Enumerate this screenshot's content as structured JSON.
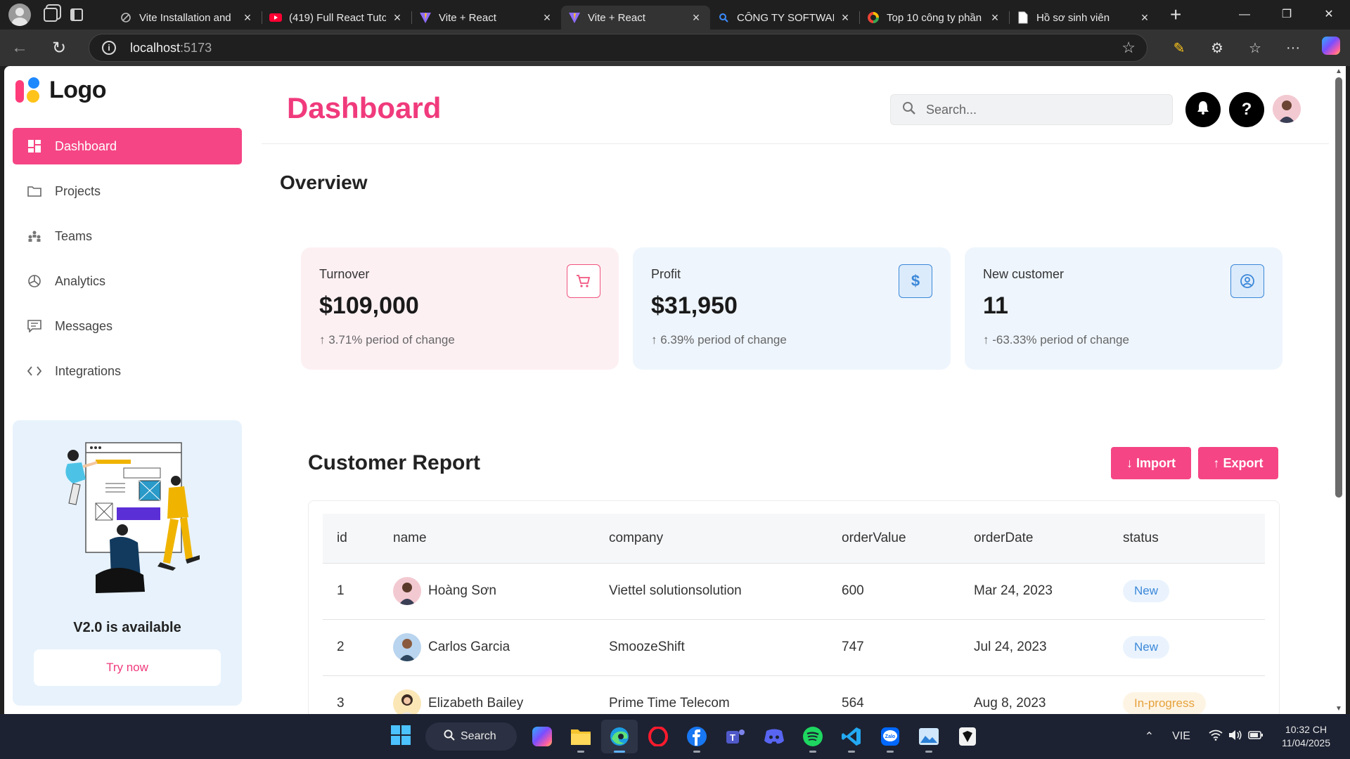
{
  "browser": {
    "tabs": [
      {
        "label": "Vite Installation and",
        "favicon": "vite-docs-icon"
      },
      {
        "label": "(419) Full React Tuto",
        "favicon": "youtube-icon"
      },
      {
        "label": "Vite + React",
        "favicon": "vite-icon"
      },
      {
        "label": "Vite + React",
        "favicon": "vite-icon",
        "active": true
      },
      {
        "label": "CÔNG TY SOFTWAR",
        "favicon": "search-icon"
      },
      {
        "label": "Top 10 công ty phần",
        "favicon": "google-icon"
      },
      {
        "label": "Hồ sơ sinh viên",
        "favicon": "document-icon"
      }
    ],
    "url_host": "localhost",
    "url_port": ":5173"
  },
  "sidebar": {
    "logo_text": "Logo",
    "items": [
      {
        "label": "Dashboard",
        "icon": "grid-icon",
        "active": true
      },
      {
        "label": "Projects",
        "icon": "folder-icon"
      },
      {
        "label": "Teams",
        "icon": "teams-icon"
      },
      {
        "label": "Analytics",
        "icon": "pie-chart-icon"
      },
      {
        "label": "Messages",
        "icon": "message-icon"
      },
      {
        "label": "Integrations",
        "icon": "code-icon"
      }
    ],
    "promo": {
      "title": "V2.0 is available",
      "button": "Try now"
    }
  },
  "header": {
    "title": "Dashboard",
    "search_placeholder": "Search...",
    "help_label": "?"
  },
  "overview": {
    "title": "Overview",
    "cards": [
      {
        "label": "Turnover",
        "value": "$109,000",
        "change": "↑ 3.71% period of change",
        "icon": "cart-icon",
        "bg": "#fdf0f3",
        "accent": "#f0547f"
      },
      {
        "label": "Profit",
        "value": "$31,950",
        "change": "↑ 6.39% period of change",
        "icon": "dollar-icon",
        "icon_text": "$",
        "bg": "#eef5fd",
        "accent": "#3b88d9"
      },
      {
        "label": "New customer",
        "value": "11",
        "change": "↑ -63.33% period of change",
        "icon": "user-circle-icon",
        "bg": "#eef5fd",
        "accent": "#3b88d9"
      }
    ]
  },
  "report": {
    "title": "Customer Report",
    "import_label": "↓  Import",
    "export_label": "↑  Export",
    "columns": [
      "id",
      "name",
      "company",
      "orderValue",
      "orderDate",
      "status"
    ],
    "rows": [
      {
        "id": "1",
        "name": "Hoàng Sơn",
        "company": "Viettel solutionsolution",
        "orderValue": "600",
        "orderDate": "Mar 24, 2023",
        "status": "New"
      },
      {
        "id": "2",
        "name": "Carlos Garcia",
        "company": "SmoozeShift",
        "orderValue": "747",
        "orderDate": "Jul 24, 2023",
        "status": "New"
      },
      {
        "id": "3",
        "name": "Elizabeth Bailey",
        "company": "Prime Time Telecom",
        "orderValue": "564",
        "orderDate": "Aug 8, 2023",
        "status": "In-progress"
      }
    ]
  },
  "taskbar": {
    "search_label": "Search",
    "language": "VIE",
    "time": "10:32 CH",
    "date": "11/04/2025"
  }
}
